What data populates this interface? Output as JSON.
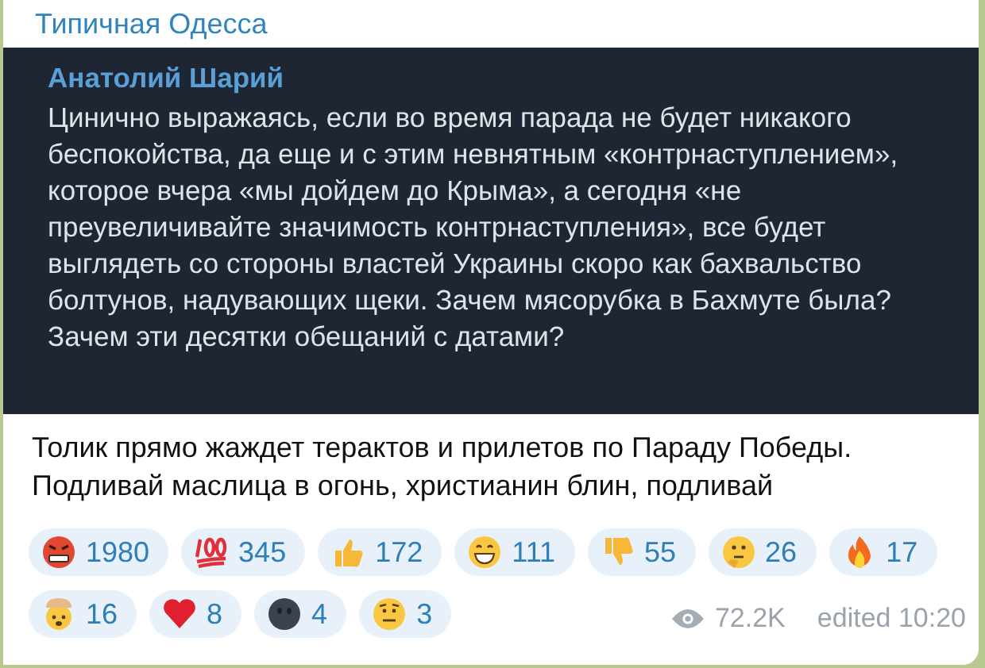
{
  "channel": {
    "title": "Типичная Одесса"
  },
  "quote": {
    "author": "Анатолий Шарий",
    "text": "Цинично выражаясь, если во время парада не будет никакого беспокойства, да еще и с этим невнятным «контрнаступлением», которое вчера «мы дойдем до Крыма», а сегодня «не преувеличивайте значимость контрнаступления», все будет выглядеть со стороны властей Украины скоро как бахвальство болтунов, надувающих щеки. Зачем мясорубка в Бахмуте была? Зачем эти десятки обещаний с датами?"
  },
  "caption": "Толик прямо жаждет терактов и прилетов по Параду Победы. Подливай маслица в огонь, христианин блин, подливай",
  "reactions": [
    {
      "kind": "angry",
      "count": "1980"
    },
    {
      "kind": "hundred",
      "count": "345"
    },
    {
      "kind": "thumbs-up",
      "count": "172"
    },
    {
      "kind": "grin",
      "count": "111"
    },
    {
      "kind": "thumbs-down",
      "count": "55"
    },
    {
      "kind": "thinking",
      "count": "26"
    },
    {
      "kind": "fire",
      "count": "17"
    },
    {
      "kind": "exploding",
      "count": "16"
    },
    {
      "kind": "heart",
      "count": "8"
    },
    {
      "kind": "dark-face",
      "count": "4"
    },
    {
      "kind": "raised-brow",
      "count": "3"
    }
  ],
  "footer": {
    "views": "72.2K",
    "edited": "edited 10:20"
  }
}
